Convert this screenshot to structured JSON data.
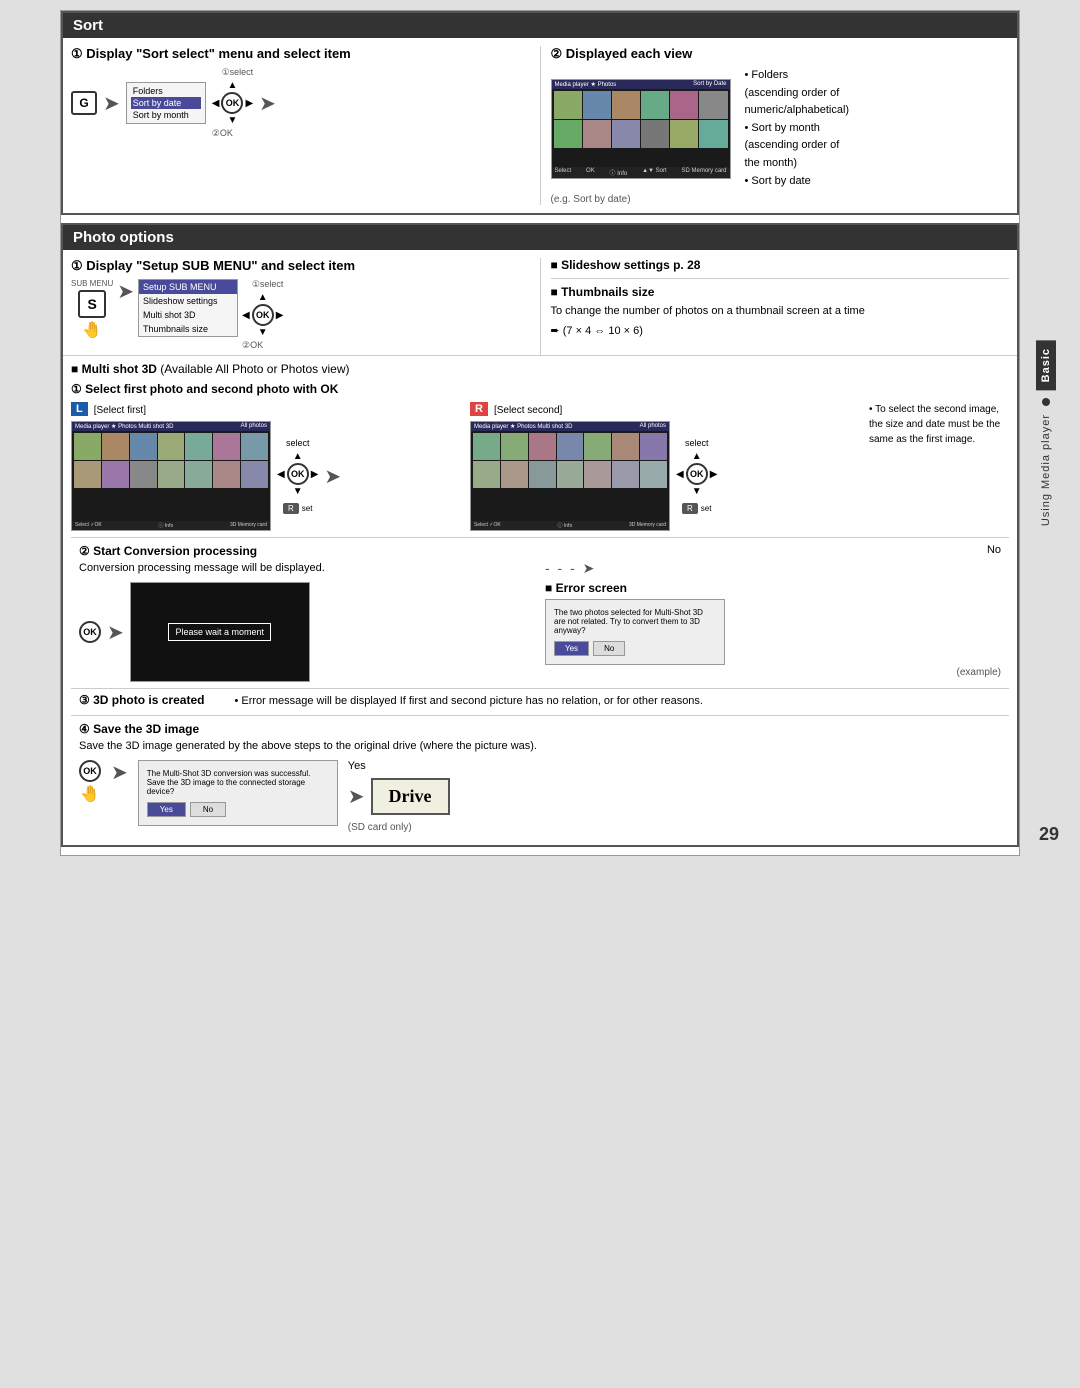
{
  "page": {
    "number": "29"
  },
  "sidebar": {
    "tab_basic": "Basic",
    "tab_media": "Using Media player"
  },
  "sort_section": {
    "title": "Sort",
    "step1_title": "① Display \"Sort select\" menu and select item",
    "step2_title": "② Displayed each view",
    "select_label": "①select",
    "ok_label": "②OK",
    "menu_items": [
      "Folders",
      "Sort by date",
      "Sort by month"
    ],
    "screen_label": "Sort by Date",
    "eg_label": "(e.g. Sort by date)",
    "bullet1": "Folders (ascending order of numeric/alphabetical)",
    "bullet2": "Sort by month (ascending order of the month)",
    "bullet3": "Sort by date"
  },
  "photo_options": {
    "title": "Photo options",
    "step1_title": "① Display \"Setup SUB MENU\" and select item",
    "select_label": "①select",
    "ok_label": "②OK",
    "sub_label": "SUB MENU",
    "s_letter": "S",
    "menu_items": [
      "Setup SUB MENU",
      "Slideshow settings",
      "Multi shot 3D",
      "Thumbnails size"
    ],
    "slideshow_title": "■ Slideshow settings p. 28",
    "thumbnails_title": "■ Thumbnails size",
    "thumbnails_desc": "To change the number of photos on a thumbnail screen at a time",
    "thumbnails_formula": "➨ (7 × 4 ⇔ 10 × 6)",
    "multishot_title": "■ Multi shot 3D",
    "multishot_note": "(Available All Photo or Photos view)",
    "select_first_title": "① Select first photo and second photo with OK",
    "select_first_label": "[Select first]",
    "select_second_label": "[Select second]",
    "l_badge": "L",
    "r_badge": "R",
    "select_text": "select",
    "set_text": "set",
    "to_select_note": "• To select the second image, the size and date must be the same as the first image.",
    "no_label": "No",
    "error_title": "■ Error screen",
    "step2_conversion": "② Start Conversion processing",
    "conversion_desc": "Conversion processing message will be displayed.",
    "processing_msg": "Please wait a moment",
    "error_msg": "The two photos selected for Multi-Shot 3D are not related. Try to convert them to 3D anyway?",
    "error_yes": "Yes",
    "error_no": "No",
    "example_label": "(example)",
    "step3_title": "③ 3D photo is created",
    "error_detail": "• Error message will be displayed If first and second picture has no relation, or for other reasons.",
    "step4_title": "④ Save the 3D image",
    "step4_desc": "Save the 3D image generated by the above steps to the original drive (where the picture was).",
    "save_msg": "The Multi-Shot 3D conversion was successful. Save the 3D image to the connected storage device?",
    "yes_label": "Yes",
    "save_yes": "Yes",
    "save_no": "No",
    "drive_label": "Drive",
    "sd_label": "(SD card only)"
  }
}
